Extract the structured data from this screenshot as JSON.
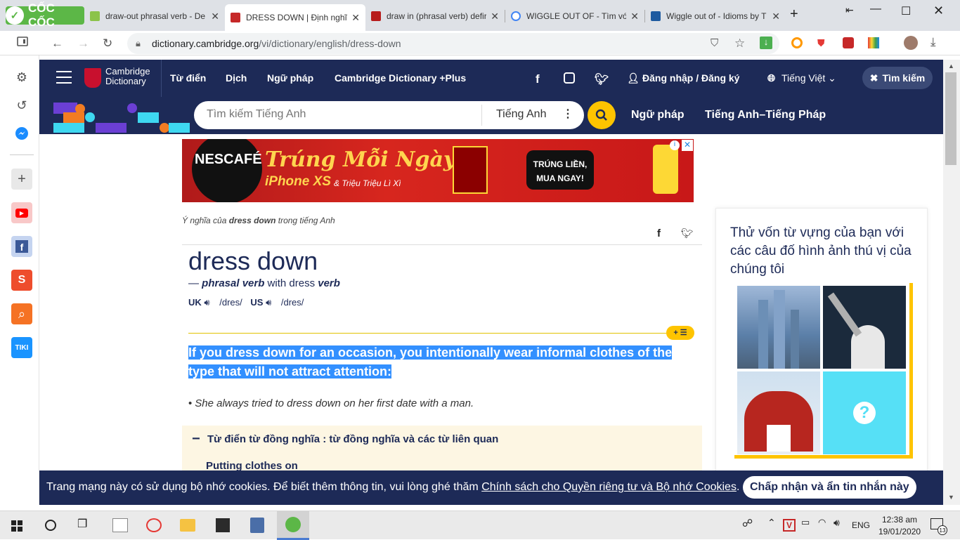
{
  "browser": {
    "brand": "CỐC CỐC",
    "tabs": [
      {
        "title": "draw-out phrasal verb - De"
      },
      {
        "title": "DRESS DOWN | Định nghĩa"
      },
      {
        "title": "draw in (phrasal verb) defir"
      },
      {
        "title": "WIGGLE OUT OF - Tìm với C"
      },
      {
        "title": "Wiggle out of - Idioms by T"
      }
    ],
    "new_tab_label": "+",
    "url_host": "dictionary.cambridge.org",
    "url_path": "/vi/dictionary/english/dress-down"
  },
  "site": {
    "logo_line1": "Cambridge",
    "logo_line2": "Dictionary",
    "nav": [
      "Từ điển",
      "Dịch",
      "Ngữ pháp",
      "Cambridge Dictionary +Plus"
    ],
    "login": "Đăng nhập / Đăng ký",
    "language": "Tiếng Việt",
    "search_button": "Tìm kiếm",
    "search_placeholder": "Tìm kiếm Tiếng Anh",
    "search_lang": "Tiếng Anh",
    "sub_nav": [
      "Ngữ pháp",
      "Tiếng Anh–Tiếng Pháp"
    ]
  },
  "ad": {
    "brand": "NESCAFÉ",
    "headline": "Trúng Mỗi Ngày",
    "subline1": "iPhone XS",
    "subline2": "& Triệu Triệu Lì Xì",
    "cta_line1": "TRÚNG LIỀN,",
    "cta_line2": "MUA NGAY!"
  },
  "entry": {
    "breadcrumb_pre": "Ý nghĩa của ",
    "breadcrumb_word": "dress down",
    "breadcrumb_post": " trong tiếng Anh",
    "headword": "dress down",
    "pos_dash": "— ",
    "pos": "phrasal verb",
    "with_text": " with dress ",
    "pos2": "verb",
    "uk_label": "UK",
    "uk_ipa": "/dres/",
    "us_label": "US",
    "us_ipa": "/dres/",
    "definition": "If you dress down for an occasion, you intentionally wear informal clothes of the type that will not attract attention:",
    "example": "She always tried to dress down on her first date with a man.",
    "thesaurus_title": "Từ điển từ đồng nghĩa : từ đồng nghĩa và các từ liên quan",
    "thesaurus_item": "Putting clothes on",
    "list_button": "+ ☰"
  },
  "quiz": {
    "title": "Thử vốn từ vựng của bạn với các câu đố hình ảnh thú vị của chúng tôi",
    "question_mark": "?"
  },
  "cookie": {
    "text_pre": "Trang mạng này có sử dụng bộ nhớ cookies. Để biết thêm thông tin, vui lòng ghé thăm ",
    "link": "Chính sách cho Quyền riêng tư và Bộ nhớ Cookies",
    "text_post": ".",
    "accept": "Chấp nhận và ẩn tin nhắn này"
  },
  "taskbar": {
    "lang": "ENG",
    "time": "12:38 am",
    "date": "19/01/2020",
    "notif_count": "13"
  },
  "colors": {
    "cambridge_navy": "#1d2a57",
    "coccoc_green": "#5cb747",
    "highlight": "#3390ff",
    "search_yellow": "#fec400"
  }
}
